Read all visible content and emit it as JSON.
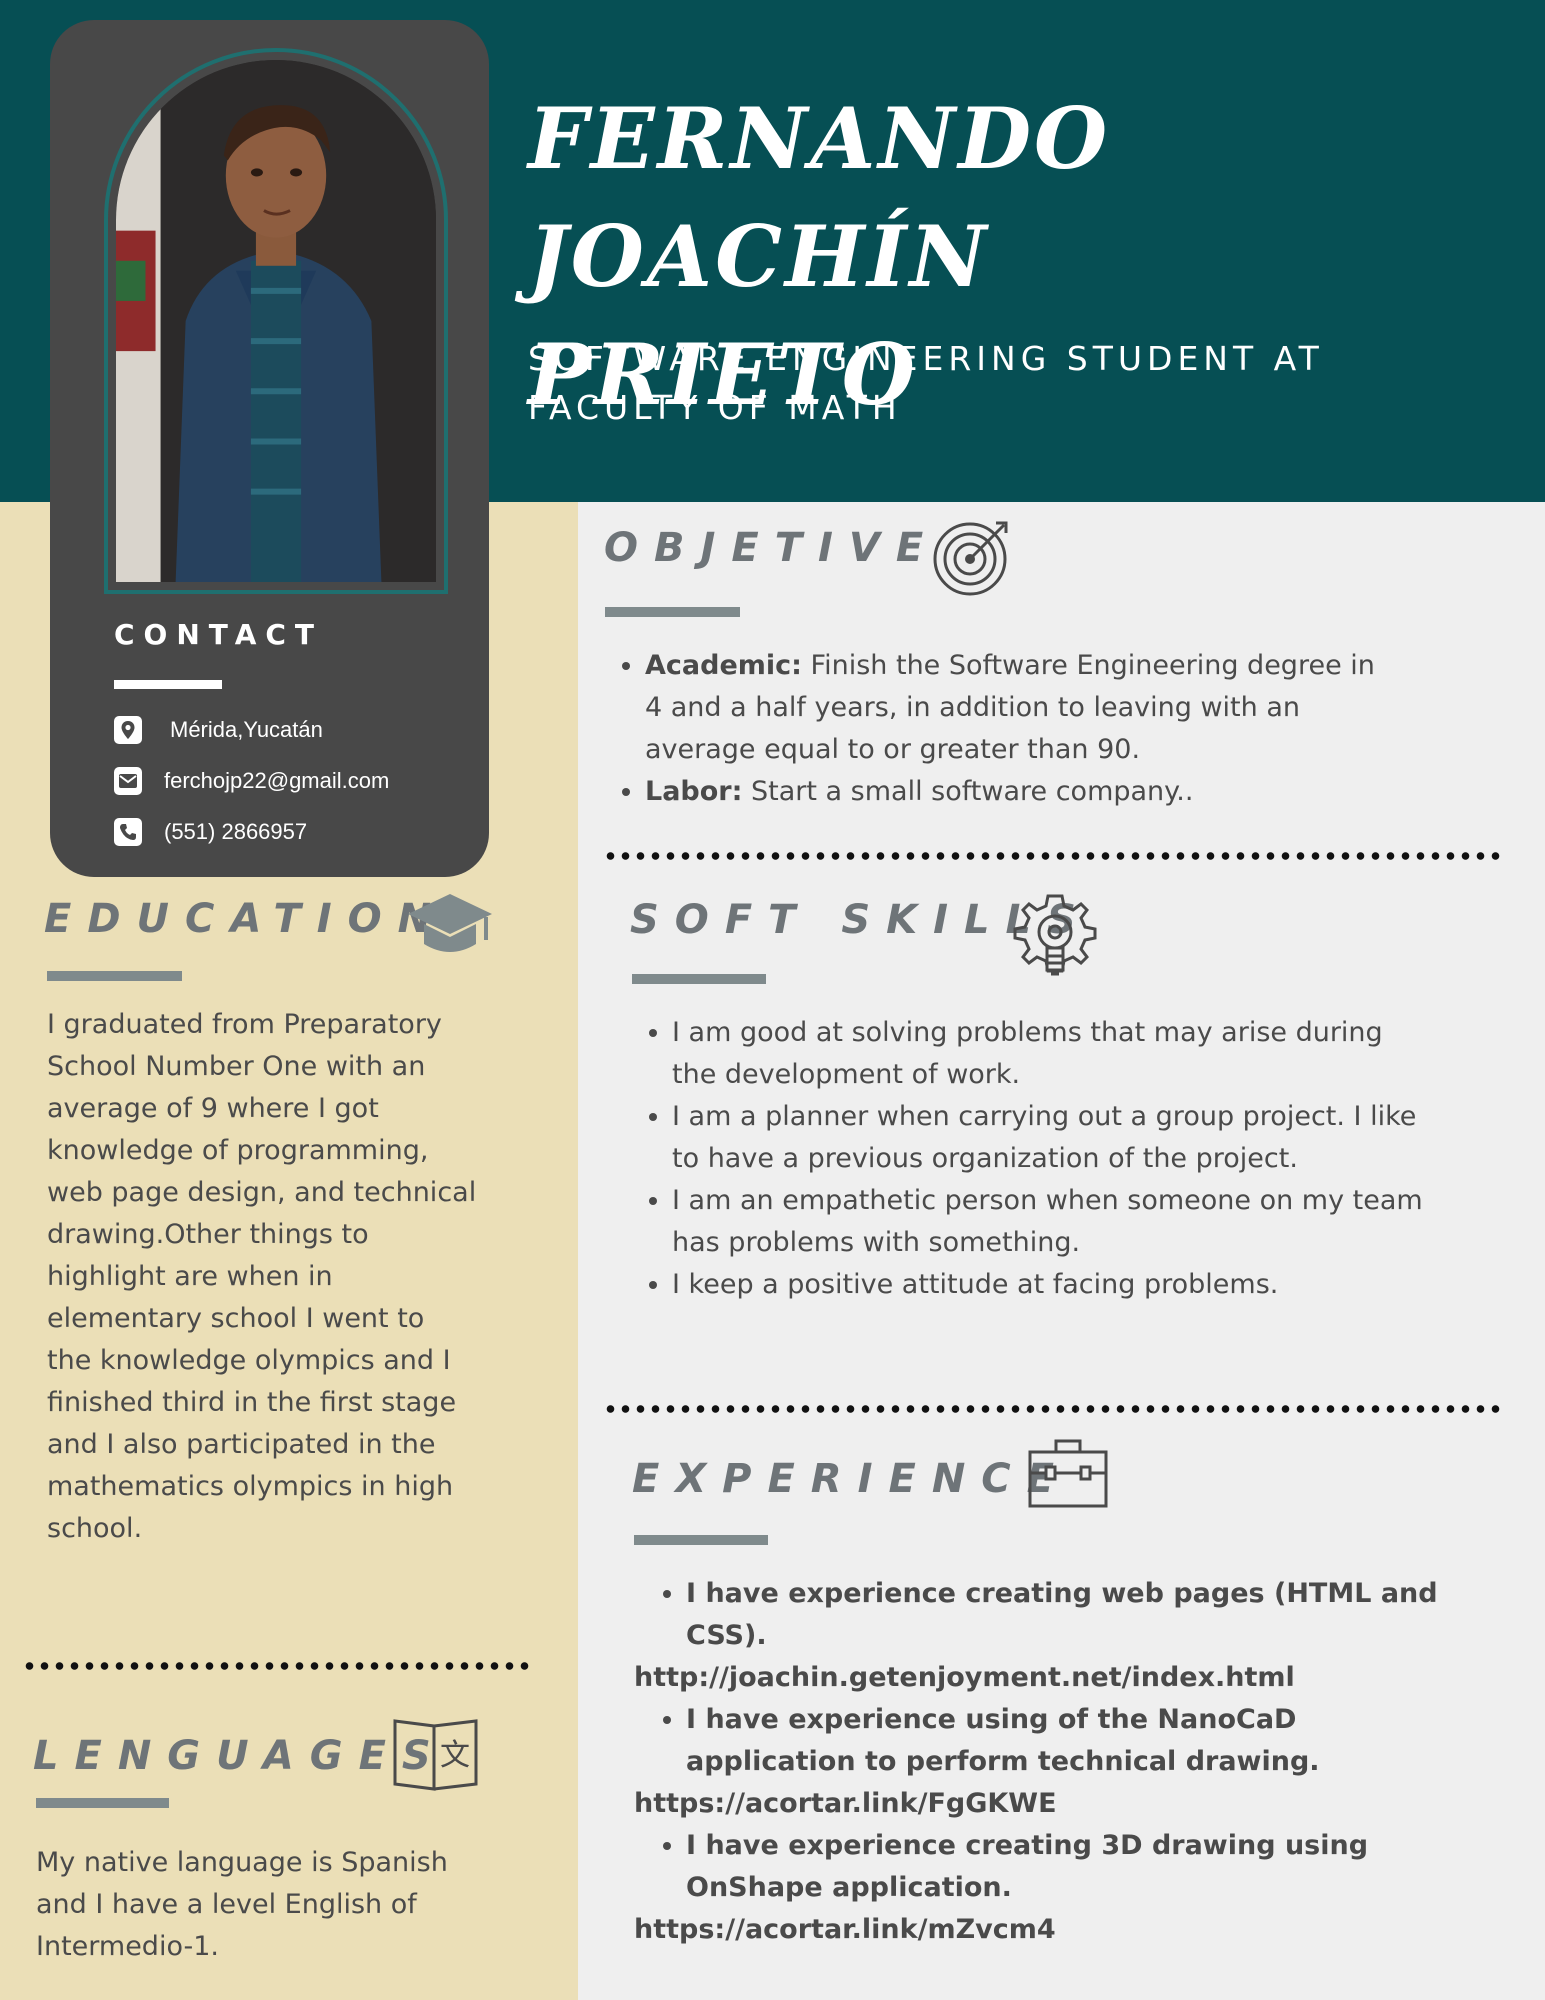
{
  "header": {
    "name_line1": "FERNANDO JOACHÍN",
    "name_line2": "PRIETO",
    "subtitle_line1": "SOFTWARE ENGINEERING STUDENT AT",
    "subtitle_line2": "FACULTY OF MATH"
  },
  "contact": {
    "title": "CONTACT",
    "location": "Mérida,Yucatán",
    "email": "ferchojp22@gmail.com",
    "phone": "(551) 2866957",
    "icons": [
      "location-pin-icon",
      "envelope-icon",
      "phone-icon"
    ]
  },
  "education": {
    "title": "EDUCATION",
    "icon": "graduation-cap-icon",
    "text": "I graduated from Preparatory School Number One with an average of 9 where I got knowledge of programming, web page design, and technical drawing.Other things to highlight are when in elementary school I went to the knowledge olympics and I finished third in the first stage and I also participated in the mathematics olympics in high school."
  },
  "languages": {
    "title": "LENGUAGES",
    "icon": "translate-book-icon",
    "text": "My native language is Spanish and I have a level English of Intermedio-1."
  },
  "objective": {
    "title": "OBJETIVE",
    "icon": "target-icon",
    "items": [
      {
        "label": "Academic:",
        "text": " Finish the Software Engineering degree in 4 and a half years, in addition to leaving with an average equal to or greater than 90."
      },
      {
        "label": "Labor:",
        "text": " Start a small software company.."
      }
    ]
  },
  "soft_skills": {
    "title": "SOFT SKILLS",
    "icon": "gear-lightbulb-icon",
    "items": [
      "I am good at solving problems that may arise during the development of work.",
      "I am a planner when carrying out a group project. I like to have a previous organization of the project.",
      "I am an empathetic person when someone on my team has problems with something.",
      "I keep a positive attitude at facing problems."
    ]
  },
  "experience": {
    "title": "EXPERIENCE",
    "icon": "briefcase-icon",
    "items": [
      {
        "text": "I have experience creating web pages (HTML and CSS).",
        "link": "http://joachin.getenjoyment.net/index.html"
      },
      {
        "text": "I have experience using of the NanoCaD application to perform technical drawing.",
        "link": "https://acortar.link/FgGKWE"
      },
      {
        "text": "I have experience creating 3D drawing using OnShape application.",
        "link": "https://acortar.link/mZvcm4"
      }
    ]
  },
  "colors": {
    "header_teal": "#064f54",
    "left_cream": "#ebdfb7",
    "right_gray": "#efefef",
    "card_dark": "#484848",
    "heading_gray": "#6e7478"
  }
}
